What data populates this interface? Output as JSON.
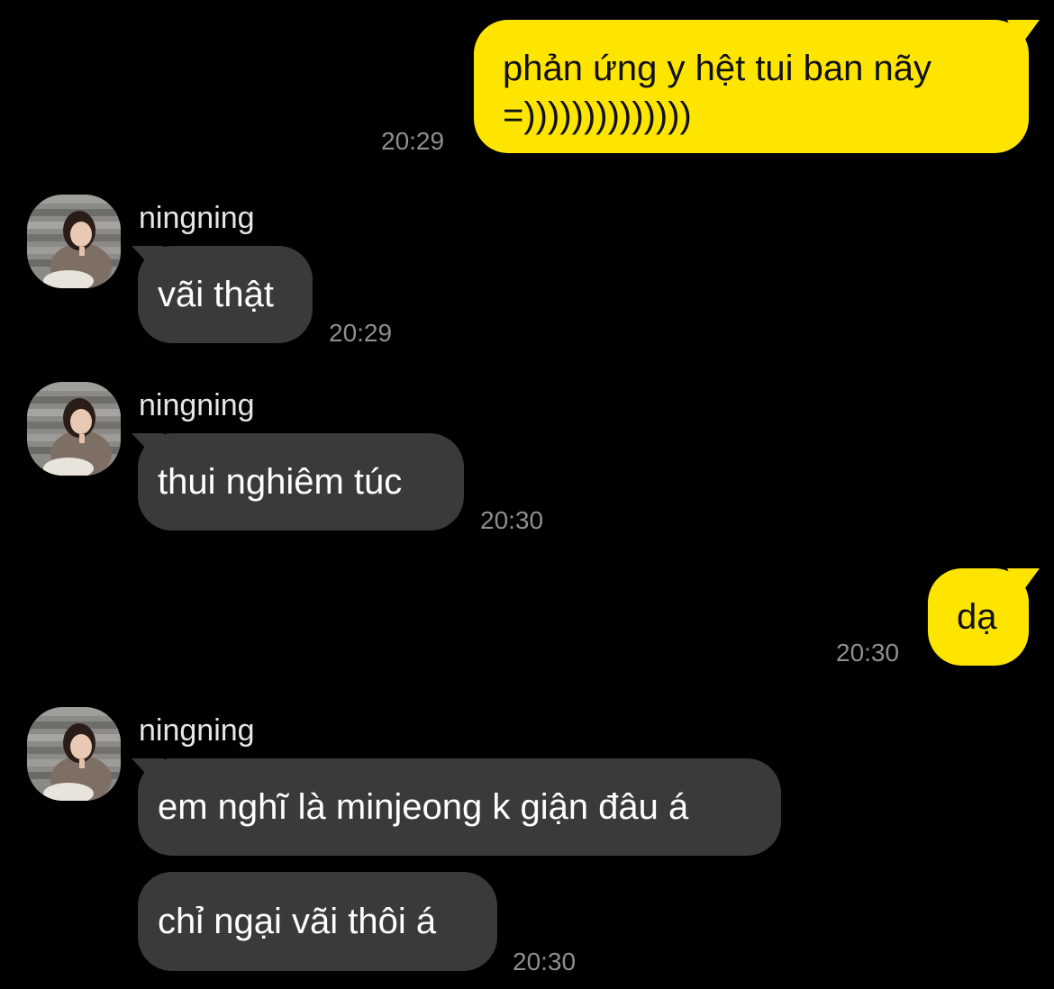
{
  "colors": {
    "background": "#000000",
    "incoming_bubble": "#3a3a3c",
    "outgoing_bubble": "#fee500",
    "timestamp": "#8e8e93"
  },
  "sender": {
    "name": "ningning",
    "avatar_icon": "profile-photo"
  },
  "messages": [
    {
      "direction": "outgoing",
      "lines": [
        "phản ứng y hệt tui ban nãy",
        "=))))))))))))))"
      ],
      "time": "20:29"
    },
    {
      "direction": "incoming",
      "sender": "ningning",
      "text": "vãi thật",
      "time": "20:29"
    },
    {
      "direction": "incoming",
      "sender": "ningning",
      "text": "thui nghiêm túc",
      "time": "20:30"
    },
    {
      "direction": "outgoing",
      "text": "dạ",
      "time": "20:30"
    },
    {
      "direction": "incoming",
      "sender": "ningning",
      "text": "em nghĩ là minjeong k giận đâu á"
    },
    {
      "direction": "incoming",
      "text": "chỉ ngại vãi thôi á",
      "time": "20:30"
    }
  ]
}
